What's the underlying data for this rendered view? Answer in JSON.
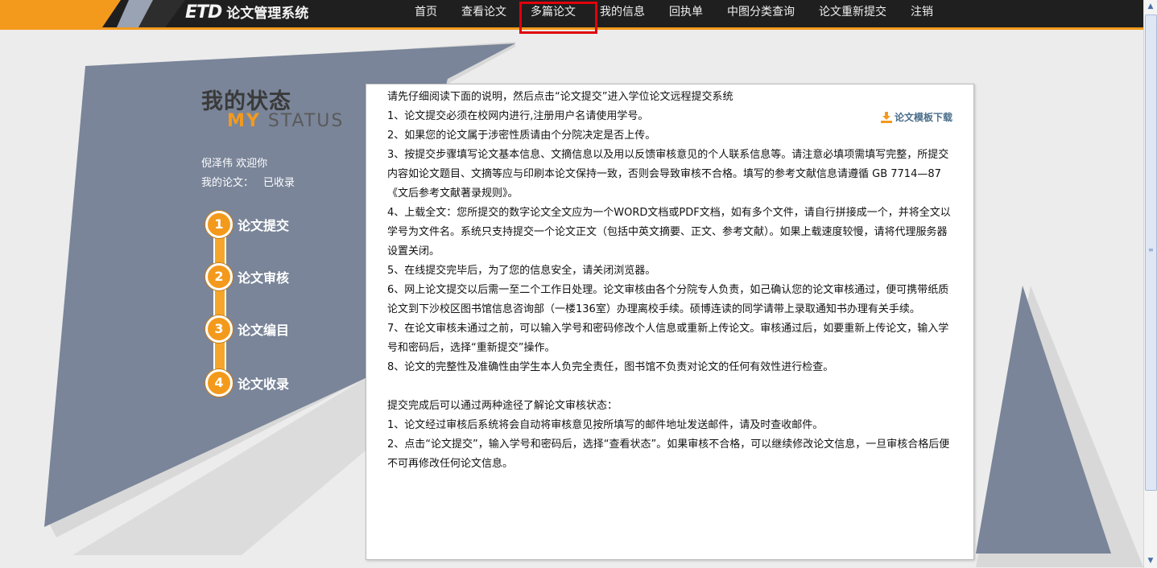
{
  "header": {
    "logo_main": "ETD",
    "logo_sub": "论文管理系统",
    "nav": [
      "首页",
      "查看论文",
      "多篇论文",
      "我的信息",
      "回执单",
      "中图分类查询",
      "论文重新提交",
      "注销"
    ]
  },
  "sidebar": {
    "title": "我的状态",
    "subtitle_my": "MY",
    "subtitle_rest": "STATUS",
    "welcome": "倪泽伟 欢迎你",
    "paper_label": "我的论文：",
    "paper_status": "已收录",
    "steps": [
      {
        "num": "1",
        "label": "论文提交"
      },
      {
        "num": "2",
        "label": "论文审核"
      },
      {
        "num": "3",
        "label": "论文编目"
      },
      {
        "num": "4",
        "label": "论文收录"
      }
    ]
  },
  "content": {
    "download_label": "论文模板下载",
    "lines": [
      "请先仔细阅读下面的说明，然后点击“论文提交”进入学位论文远程提交系统",
      "1、论文提交必须在校网内进行,注册用户名请使用学号。",
      "2、如果您的论文属于涉密性质请由个分院决定是否上传。",
      "3、按提交步骤填写论文基本信息、文摘信息以及用以反馈审核意见的个人联系信息等。请注意必填项需填写完整，所提交内容如论文题目、文摘等应与印刷本论文保持一致，否则会导致审核不合格。填写的参考文献信息请遵循 GB 7714—87《文后参考文献著录规则》。",
      "4、上载全文：您所提交的数字论文全文应为一个WORD文档或PDF文档，如有多个文件，请自行拼接成一个，并将全文以学号为文件名。系统只支持提交一个论文正文（包括中英文摘要、正文、参考文献）。如果上载速度较慢，请将代理服务器设置关闭。",
      "5、在线提交完毕后，为了您的信息安全，请关闭浏览器。",
      "6、网上论文提交以后需一至二个工作日处理。论文审核由各个分院专人负责，如己确认您的论文审核通过，便可携带纸质论文到下沙校区图书馆信息咨询部（一楼136室）办理离校手续。硕博连读的同学请带上录取通知书办理有关手续。",
      "7、在论文审核未通过之前，可以输入学号和密码修改个人信息或重新上传论文。审核通过后，如要重新上传论文，输入学号和密码后，选择“重新提交”操作。",
      "8、论文的完整性及准确性由学生本人负完全责任，图书馆不负责对论文的任何有效性进行检查。"
    ],
    "lines2": [
      "提交完成后可以通过两种途径了解论文审核状态：",
      "1、论文经过审核后系统将会自动将审核意见按所填写的邮件地址发送邮件，请及时查收邮件。",
      "2、点击“论文提交”，输入学号和密码后，选择“查看状态”。如果审核不合格，可以继续修改论文信息，一旦审核合格后便不可再修改任何论文信息。"
    ]
  }
}
